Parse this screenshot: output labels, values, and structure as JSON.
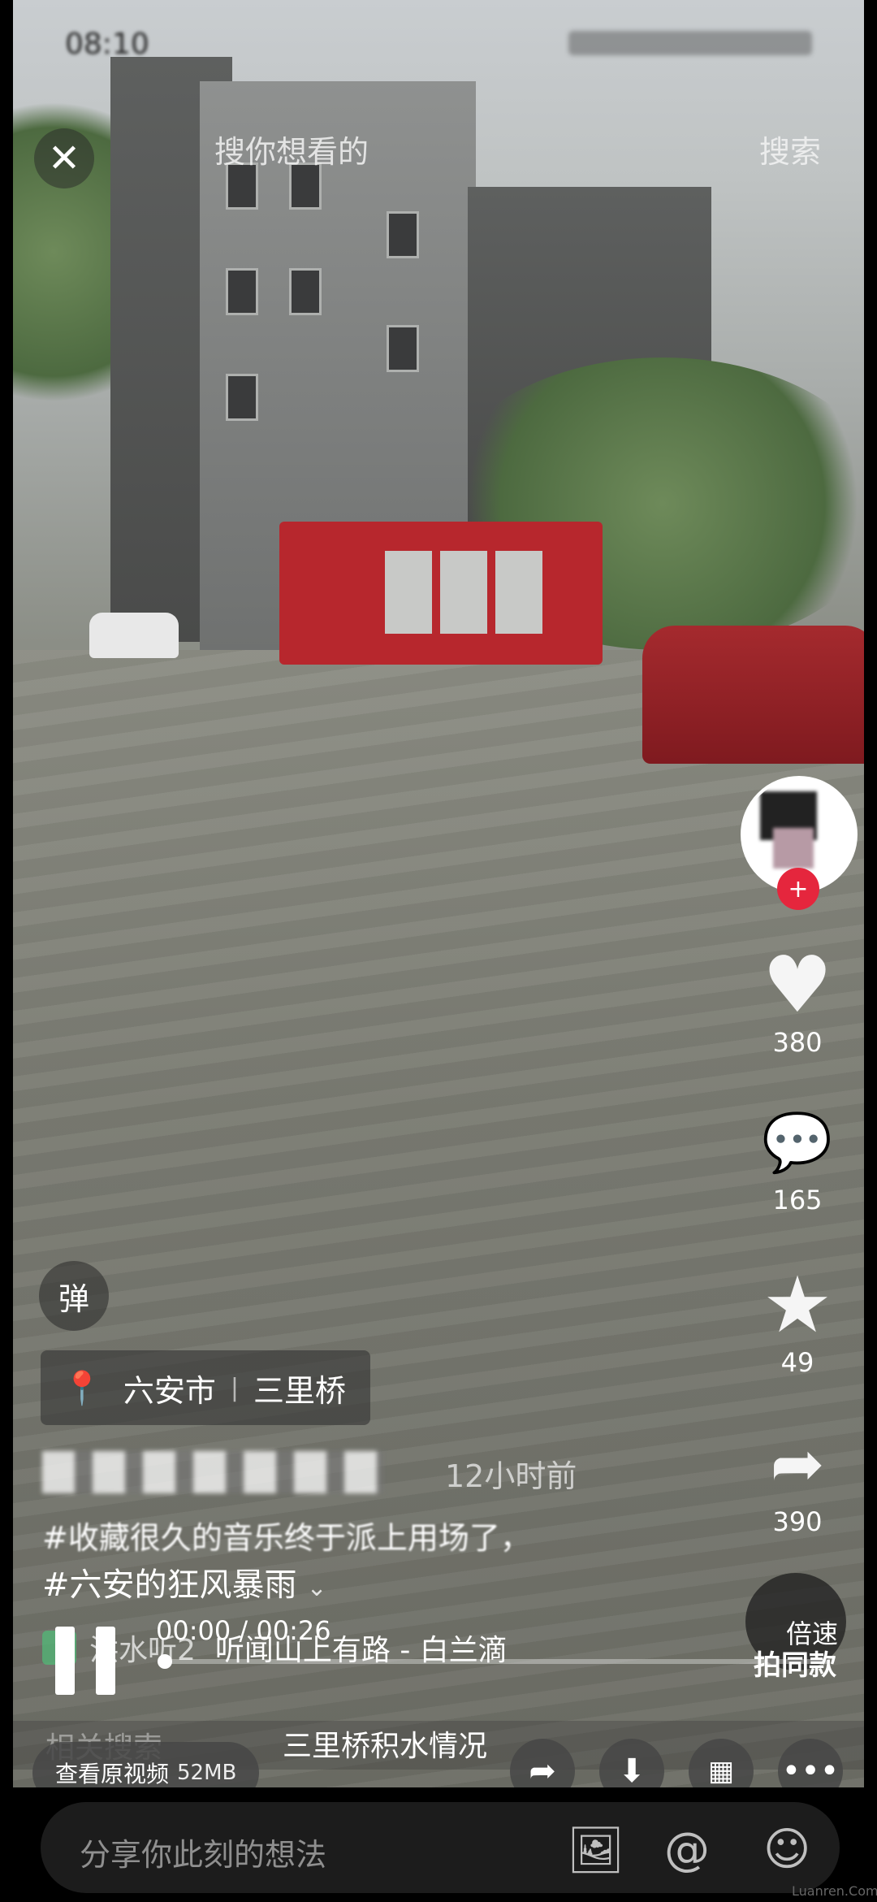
{
  "status_bar": {
    "time": "08:10"
  },
  "top": {
    "search_hint": "搜你想看的",
    "search_link": "搜索"
  },
  "side": {
    "like_count": "380",
    "comment_count": "165",
    "favorite_count": "49",
    "share_count": "390"
  },
  "danmu_label": "弹",
  "location": {
    "city": "六安市",
    "place": "三里桥"
  },
  "post": {
    "time_ago": "12小时前",
    "desc_line1": "#收藏很久的音乐终于派上用场了，",
    "desc_line2": "#六安的狂风暴雨"
  },
  "music": {
    "title": "听闻山上有路 - 白兰滴",
    "prefix": "洪水听2"
  },
  "player": {
    "time": "00:00 / 00:26",
    "progress": 0.0,
    "speed_label": "倍速",
    "same_style_label": "拍同款"
  },
  "related": {
    "label": "相关搜索",
    "term": "三里桥积水情况"
  },
  "bottom_actions": {
    "view_original": "查看原视频",
    "size": "52MB"
  },
  "comment": {
    "placeholder": "分享你此刻的想法"
  },
  "watermark": "Luanren.Com"
}
